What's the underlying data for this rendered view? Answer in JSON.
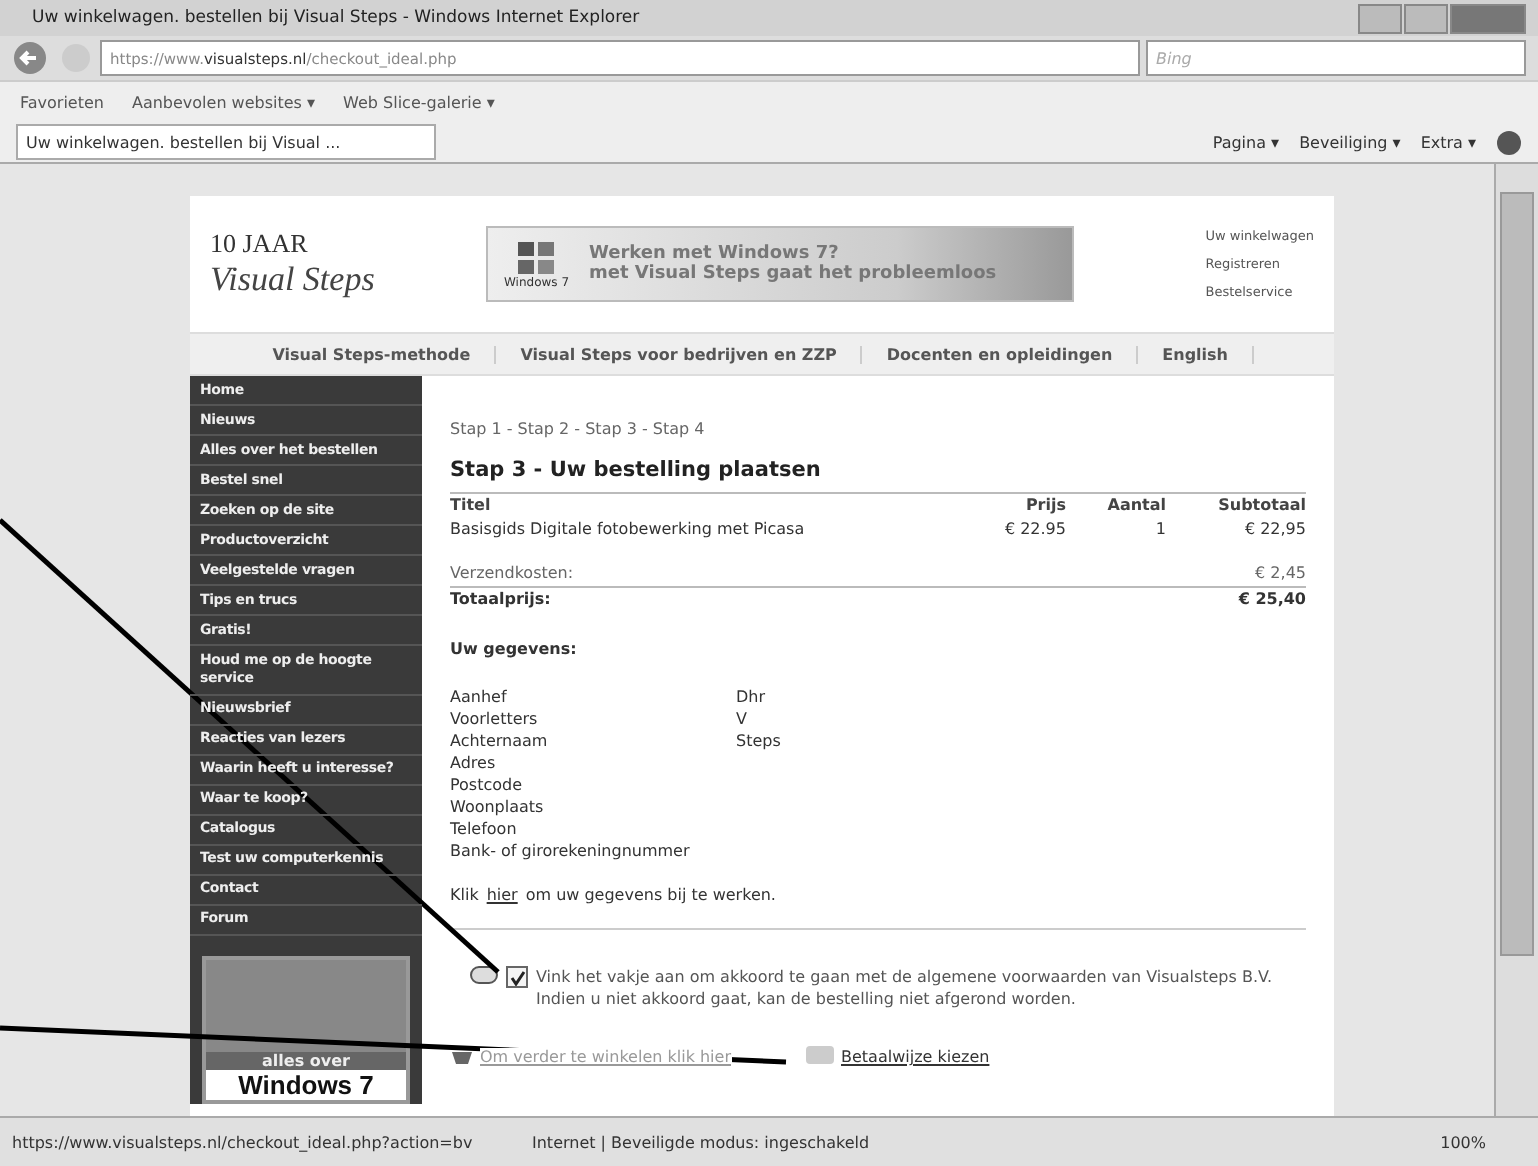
{
  "window": {
    "title": "Uw winkelwagen. bestellen bij Visual Steps - Windows Internet Explorer"
  },
  "address_bar": {
    "url_prefix": "https://www.",
    "url_domain": "visualsteps.nl",
    "url_path": "/checkout_ideal.php",
    "search_placeholder": "Bing"
  },
  "favorites_bar": {
    "items": [
      "Favorieten",
      "Aanbevolen websites ▾",
      "Web Slice-galerie ▾"
    ]
  },
  "tab": {
    "title": "Uw winkelwagen. bestellen bij Visual ..."
  },
  "command_bar": {
    "items": [
      "Pagina ▾",
      "Beveiliging ▾",
      "Extra ▾"
    ]
  },
  "site": {
    "logo": {
      "years": "10 JAAR",
      "name": "Visual Steps"
    },
    "banner": {
      "badge": "Windows 7",
      "line_1": "Werken met Windows 7?",
      "line_2": "met Visual Steps",
      "line_3": "gaat het probleemloos"
    },
    "top_links": [
      "Uw winkelwagen",
      "Registreren",
      "Bestelservice"
    ],
    "nav": [
      "Visual Steps-methode",
      "Visual Steps voor bedrijven en ZZP",
      "Docenten en opleidingen",
      "English"
    ],
    "sidebar": {
      "items": [
        "Home",
        "Nieuws",
        "Alles over het bestellen",
        "Bestel snel",
        "Zoeken op de site",
        "Productoverzicht",
        "Veelgestelde vragen",
        "Tips en trucs",
        "Gratis!",
        "Houd me op de hoogte service",
        "Nieuwsbrief",
        "Reacties van lezers",
        "Waarin heeft u interesse?",
        "Waar te koop?",
        "Catalogus",
        "Test uw computerkennis",
        "Contact",
        "Forum"
      ],
      "promo": {
        "line_1": "alles over",
        "line_2": "Windows 7"
      }
    }
  },
  "checkout": {
    "breadcrumb": "Stap 1 - Stap 2 - Stap 3 - Stap 4",
    "heading": "Stap 3 - Uw bestelling plaatsen",
    "columns": [
      "Titel",
      "Prijs",
      "Aantal",
      "Subtotaal"
    ],
    "rows": [
      [
        "Basisgids Digitale fotobewerking met Picasa",
        "€ 22.95",
        "1",
        "€ 22,95"
      ]
    ],
    "shipping": {
      "label": "Verzendkosten:",
      "value": "€ 2,45"
    },
    "total": {
      "label": "Totaalprijs:",
      "value": "€ 25,40"
    },
    "details_heading": "Uw gegevens:",
    "details": [
      {
        "label": "Aanhef",
        "value": "Dhr"
      },
      {
        "label": "Voorletters",
        "value": "V"
      },
      {
        "label": "Achternaam",
        "value": "Steps"
      },
      {
        "label": "Adres"
      },
      {
        "label": "Postcode"
      },
      {
        "label": "Woonplaats"
      },
      {
        "label": "Telefoon"
      },
      {
        "label": "Bank- of girorekeningnummer"
      }
    ],
    "edit_note": {
      "before": "Klik",
      "link": "hier",
      "after": "om uw gegevens bij te werken."
    },
    "terms": {
      "checked": true,
      "text": "Vink het vakje aan om akkoord te gaan met de algemene voorwaarden van Visualsteps B.V. Indien u niet akkoord gaat, kan de bestelling niet afgerond worden."
    },
    "continue_link": "Om verder te winkelen klik hier",
    "pay_link": "Betaalwijze kiezen"
  },
  "status_bar": {
    "url": "https://www.visualsteps.nl/checkout_ideal.php?action=bv",
    "zone": "Internet | Beveiligde modus: ingeschakeld",
    "zoom": "100%"
  }
}
